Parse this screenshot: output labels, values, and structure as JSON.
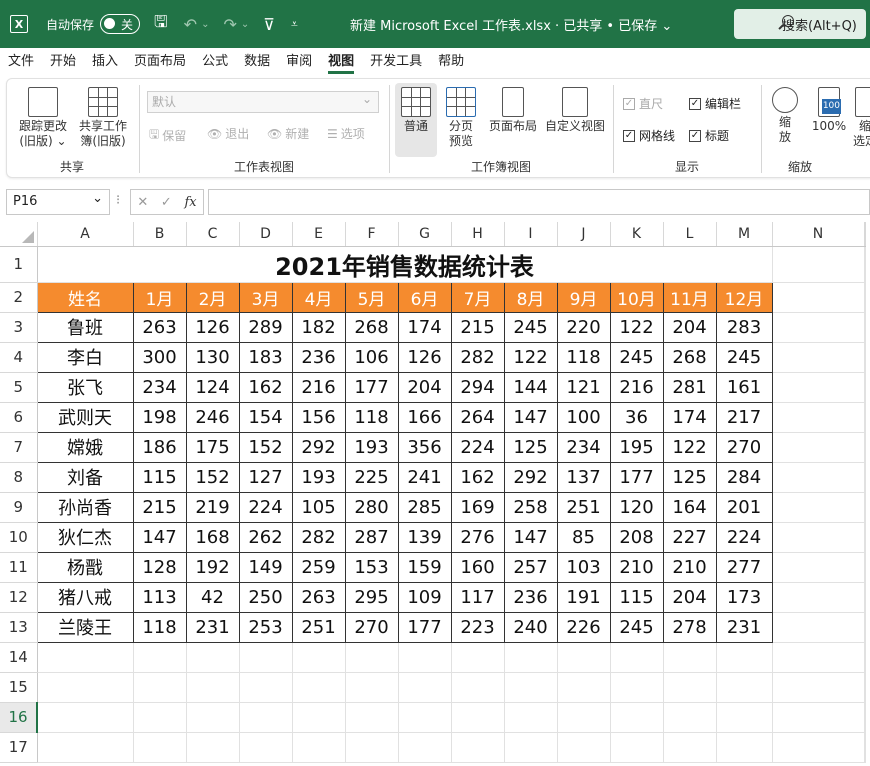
{
  "titlebar": {
    "excel_logo": "X",
    "autosave_label": "自动保存",
    "autosave_state": "关",
    "doc_title": "新建 Microsoft Excel 工作表.xlsx  ·  已共享 • 已保存  ⌄",
    "search_label": "搜索(Alt+Q)",
    "bg_color": "#217346"
  },
  "menu": [
    "文件",
    "开始",
    "插入",
    "页面布局",
    "公式",
    "数据",
    "审阅",
    "视图",
    "开发工具",
    "帮助"
  ],
  "menu_active": "视图",
  "ribbon": {
    "share_group": {
      "track_changes": "跟踪更改\n(旧版) ⌄",
      "share_workbook": "共享工作\n簿(旧版)",
      "label": "共享"
    },
    "sheet_view_group": {
      "dropdown": "默认",
      "keep": "保留",
      "exit": "退出",
      "new": "新建",
      "options": "选项",
      "label": "工作表视图"
    },
    "workbook_view_group": {
      "normal": "普通",
      "page_break": "分页\n预览",
      "page_layout": "页面布局",
      "custom_view": "自定义视图",
      "label": "工作簿视图"
    },
    "show_group": {
      "ruler": "直尺",
      "formula_bar": "编辑栏",
      "gridlines": "网格线",
      "headings": "标题",
      "label": "显示"
    },
    "zoom_group": {
      "zoom": "缩\n放",
      "zoom_100": "100%",
      "zoom_sel": "缩\n选定",
      "label": "缩放"
    }
  },
  "formula_bar": {
    "name_box": "P16",
    "cancel": "✕",
    "enter": "✓",
    "fx": "fx",
    "content": ""
  },
  "sheet": {
    "columns": [
      "A",
      "B",
      "C",
      "D",
      "E",
      "F",
      "G",
      "H",
      "I",
      "J",
      "K",
      "L",
      "M",
      "N"
    ],
    "rows": [
      "1",
      "2",
      "3",
      "4",
      "5",
      "6",
      "7",
      "8",
      "9",
      "10",
      "11",
      "12",
      "13",
      "14",
      "15",
      "16",
      "17"
    ],
    "selected_row": "16",
    "title": "2021年销售数据统计表",
    "headers": [
      "姓名",
      "1月",
      "2月",
      "3月",
      "4月",
      "5月",
      "6月",
      "7月",
      "8月",
      "9月",
      "10月",
      "11月",
      "12月"
    ],
    "header_color": "#f58b2e",
    "data": [
      [
        "鲁班",
        "263",
        "126",
        "289",
        "182",
        "268",
        "174",
        "215",
        "245",
        "220",
        "122",
        "204",
        "283"
      ],
      [
        "李白",
        "300",
        "130",
        "183",
        "236",
        "106",
        "126",
        "282",
        "122",
        "118",
        "245",
        "268",
        "245"
      ],
      [
        "张飞",
        "234",
        "124",
        "162",
        "216",
        "177",
        "204",
        "294",
        "144",
        "121",
        "216",
        "281",
        "161"
      ],
      [
        "武则天",
        "198",
        "246",
        "154",
        "156",
        "118",
        "166",
        "264",
        "147",
        "100",
        "36",
        "174",
        "217"
      ],
      [
        "嫦娥",
        "186",
        "175",
        "152",
        "292",
        "193",
        "356",
        "224",
        "125",
        "234",
        "195",
        "122",
        "270"
      ],
      [
        "刘备",
        "115",
        "152",
        "127",
        "193",
        "225",
        "241",
        "162",
        "292",
        "137",
        "177",
        "125",
        "284"
      ],
      [
        "孙尚香",
        "215",
        "219",
        "224",
        "105",
        "280",
        "285",
        "169",
        "258",
        "251",
        "120",
        "164",
        "201"
      ],
      [
        "狄仁杰",
        "147",
        "168",
        "262",
        "282",
        "287",
        "139",
        "276",
        "147",
        "85",
        "208",
        "227",
        "224"
      ],
      [
        "杨戬",
        "128",
        "192",
        "149",
        "259",
        "153",
        "159",
        "160",
        "257",
        "103",
        "210",
        "210",
        "277"
      ],
      [
        "猪八戒",
        "113",
        "42",
        "250",
        "263",
        "295",
        "109",
        "117",
        "236",
        "191",
        "115",
        "204",
        "173"
      ],
      [
        "兰陵王",
        "118",
        "231",
        "253",
        "251",
        "270",
        "177",
        "223",
        "240",
        "226",
        "245",
        "278",
        "231"
      ]
    ]
  }
}
